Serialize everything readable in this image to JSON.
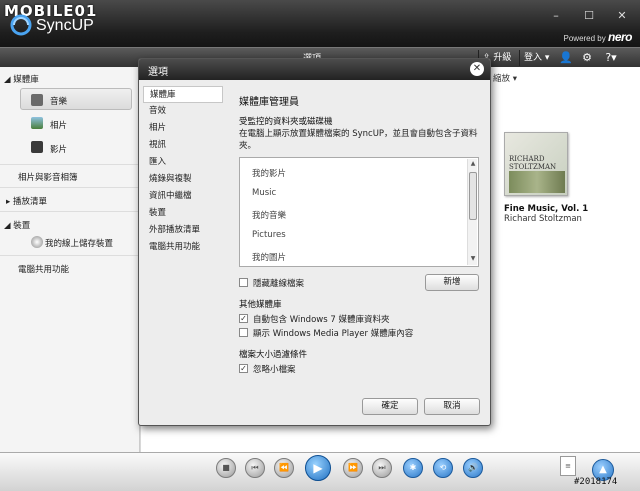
{
  "app": {
    "logo_mobile": "MOBILE01",
    "logo_name": "SyncUP",
    "powered_by": "Powered by",
    "powered_brand": "nero"
  },
  "window_controls": {
    "close": "✕",
    "minimize": "–",
    "maximize": "☐"
  },
  "menubar": {
    "title": "選項",
    "upgrade": "升級",
    "login": "登入",
    "help": "?"
  },
  "sidebar": {
    "library_header": "媒體庫",
    "items": [
      {
        "label": "音樂"
      },
      {
        "label": "相片"
      },
      {
        "label": "影片"
      }
    ],
    "photos_video": "相片與影音相簿",
    "playlists": "播放清單",
    "devices_header": "裝置",
    "device_item": "我的線上儲存裝置",
    "pc_sharing": "電腦共用功能"
  },
  "content": {
    "shrink_label": "縮放",
    "search_placeholder": "搜尋",
    "album": {
      "title": "Fine Music, Vol. 1",
      "artist": "Richard Stoltzman",
      "cover_text": "RICHARD STOLTZMAN"
    }
  },
  "dialog": {
    "title": "選項",
    "close": "✕",
    "nav": [
      "媒體庫",
      "音效",
      "相片",
      "視訊",
      "匯入",
      "燒錄與複製",
      "資訊中繼檔",
      "裝置",
      "外部播放清單",
      "電腦共用功能"
    ],
    "active_nav": 0,
    "heading": "媒體庫管理員",
    "monitored_heading": "受監控的資料夾或磁碟機",
    "monitored_desc_1": "在電腦上顯示放置媒體檔案的 SyncUP，並且會自動包含子資料",
    "monitored_desc_2": "夾。",
    "folders": [
      "我的影片",
      "Music",
      "我的音樂",
      "Pictures",
      "我的圖片"
    ],
    "hide_offline_label": "隱藏離線檔案",
    "hide_offline_checked": false,
    "add_button": "新增",
    "other_libs_heading": "其他媒體庫",
    "auto_include_label": "自動包含 Windows 7 媒體庫資料夾",
    "auto_include_checked": true,
    "show_wmp_label": "顯示 Windows Media Player 媒體庫內容",
    "show_wmp_checked": false,
    "filesize_heading": "檔案大小過濾條件",
    "ignore_small_label": "忽略小檔案",
    "ignore_small_checked": true,
    "ok_button": "確定",
    "cancel_button": "取消"
  },
  "player": {
    "stop": "■",
    "prev": "⏮",
    "rewind": "⏪",
    "play": "▶",
    "forward": "⏩",
    "next": "⏭",
    "shuffle": "✱",
    "repeat": "⟲",
    "volume": "🔊",
    "corner": "▲",
    "doc": "≡"
  },
  "watermark": "#2018174"
}
